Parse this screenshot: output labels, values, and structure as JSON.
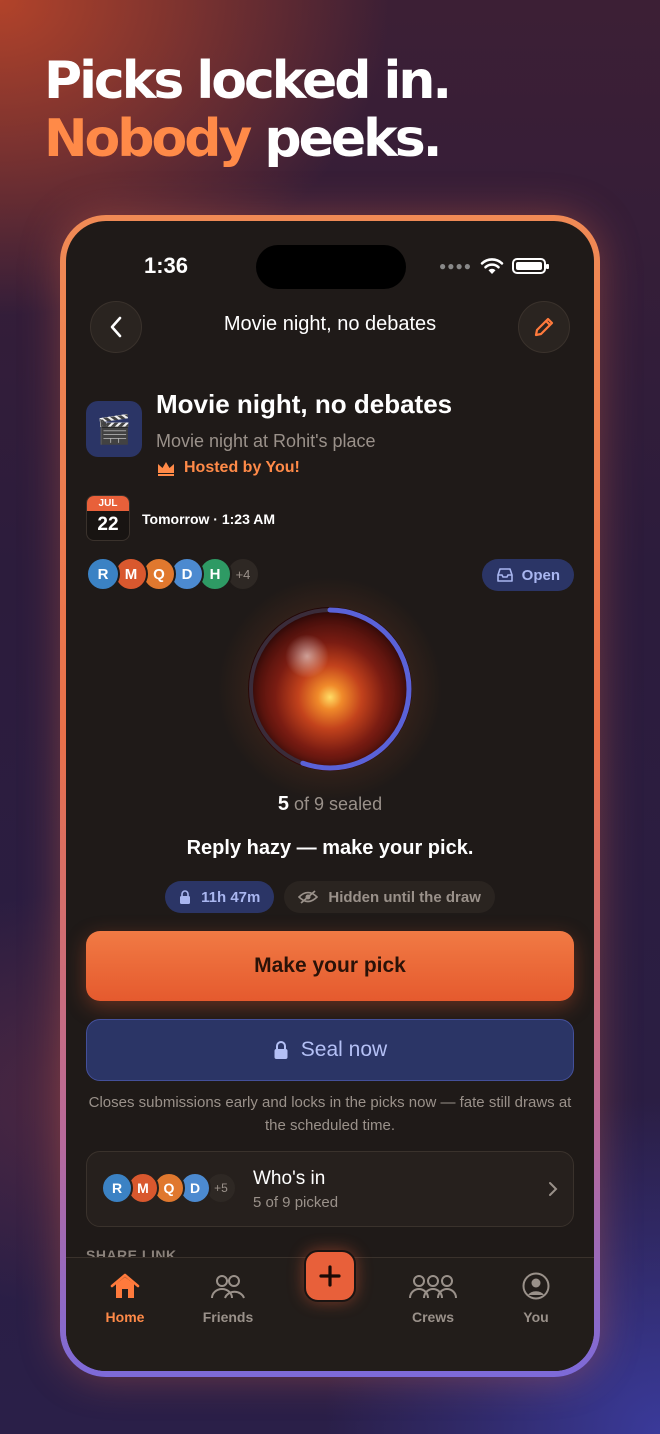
{
  "headline": {
    "line1": "Picks locked in.",
    "line2_accent": "Nobody",
    "line2_rest": " peeks."
  },
  "status_bar": {
    "time": "1:36",
    "icons": [
      "signal-icon",
      "wifi-icon",
      "battery-icon"
    ]
  },
  "nav": {
    "title": "Movie night, no debates",
    "back_icon": "chevron-left-icon",
    "edit_icon": "pencil-icon"
  },
  "event": {
    "icon": "🎬",
    "title": "Movie night, no debates",
    "subtitle": "Movie night at Rohit's place",
    "host_label": "Hosted by You!",
    "date_month": "JUL",
    "date_day": "22",
    "date_text": "Tomorrow · 1:23 AM"
  },
  "participants": {
    "avatars": [
      {
        "initial": "R",
        "color": "#3b82c4"
      },
      {
        "initial": "M",
        "color": "#d9582e"
      },
      {
        "initial": "Q",
        "color": "#e0782e"
      },
      {
        "initial": "D",
        "color": "#4c8ad0"
      },
      {
        "initial": "H",
        "color": "#2e9a64"
      }
    ],
    "more": "+4",
    "status_pill": "Open"
  },
  "orb": {
    "sealed_count": "5",
    "sealed_rest": " of 9 sealed",
    "progress": 0.5556
  },
  "message": "Reply hazy — make your pick.",
  "chips": {
    "timer": "11h 47m",
    "hidden": "Hidden until the draw"
  },
  "actions": {
    "primary": "Make your pick",
    "seal": "Seal now",
    "seal_note": "Closes submissions early and locks in the picks now — fate still draws at the scheduled time."
  },
  "whos_in": {
    "avatars": [
      {
        "initial": "R",
        "color": "#3b82c4"
      },
      {
        "initial": "M",
        "color": "#d9582e"
      },
      {
        "initial": "Q",
        "color": "#e0782e"
      },
      {
        "initial": "D",
        "color": "#4c8ad0"
      }
    ],
    "more": "+5",
    "title": "Who's in",
    "subtitle": "5 of 9 picked"
  },
  "share_label": "SHARE LINK",
  "tabbar": {
    "home": "Home",
    "friends": "Friends",
    "crews": "Crews",
    "you": "You"
  },
  "colors": {
    "accent": "#ff8a48",
    "primary_button": "#e8603a",
    "indigo": "#2b3566",
    "background": "#1f1a18"
  }
}
